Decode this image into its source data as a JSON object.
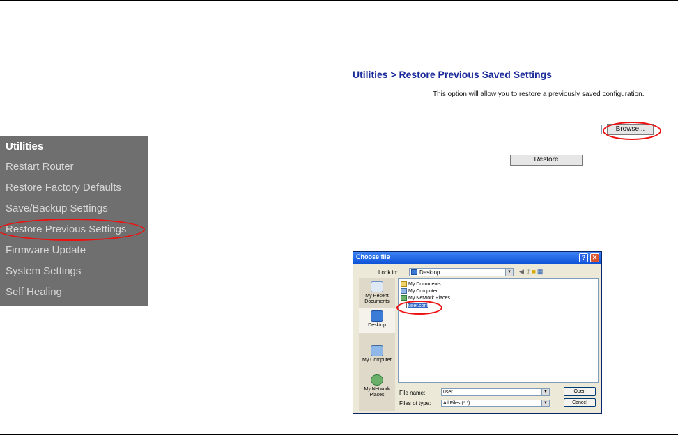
{
  "sidebar": {
    "heading": "Utilities",
    "items": [
      {
        "label": "Restart Router"
      },
      {
        "label": "Restore Factory Defaults"
      },
      {
        "label": "Save/Backup Settings"
      },
      {
        "label": "Restore Previous Settings"
      },
      {
        "label": "Firmware Update"
      },
      {
        "label": "System Settings"
      },
      {
        "label": "Self Healing"
      }
    ]
  },
  "main": {
    "title": "Utilities > Restore Previous Saved Settings",
    "description": "This option will allow you to restore a previously saved configuration.",
    "file_input_value": "",
    "browse_label": "Browse...",
    "restore_label": "Restore"
  },
  "dialog": {
    "title": "Choose file",
    "help_glyph": "?",
    "close_glyph": "✕",
    "look_in_label": "Look in:",
    "look_in_value": "Desktop",
    "places": [
      {
        "label": "My Recent Documents",
        "icon": "recent-documents-icon"
      },
      {
        "label": "Desktop",
        "icon": "desktop-icon"
      },
      {
        "label": "My Computer",
        "icon": "my-computer-icon"
      },
      {
        "label": "My Network Places",
        "icon": "network-places-icon"
      }
    ],
    "files": [
      {
        "name": "My Documents",
        "icon": "folder-icon"
      },
      {
        "name": "My Computer",
        "icon": "computer-icon"
      },
      {
        "name": "My Network Places",
        "icon": "network-icon"
      },
      {
        "name": "user.conf",
        "icon": "file-icon"
      }
    ],
    "file_name_label": "File name:",
    "file_name_value": "user",
    "files_of_type_label": "Files of type:",
    "files_of_type_value": "All Files (*.*)",
    "open_label": "Open",
    "cancel_label": "Cancel"
  },
  "colors": {
    "sidebar_bg": "#6f6f6f",
    "title_blue": "#1a2a9a",
    "highlight_red": "#e11111"
  }
}
